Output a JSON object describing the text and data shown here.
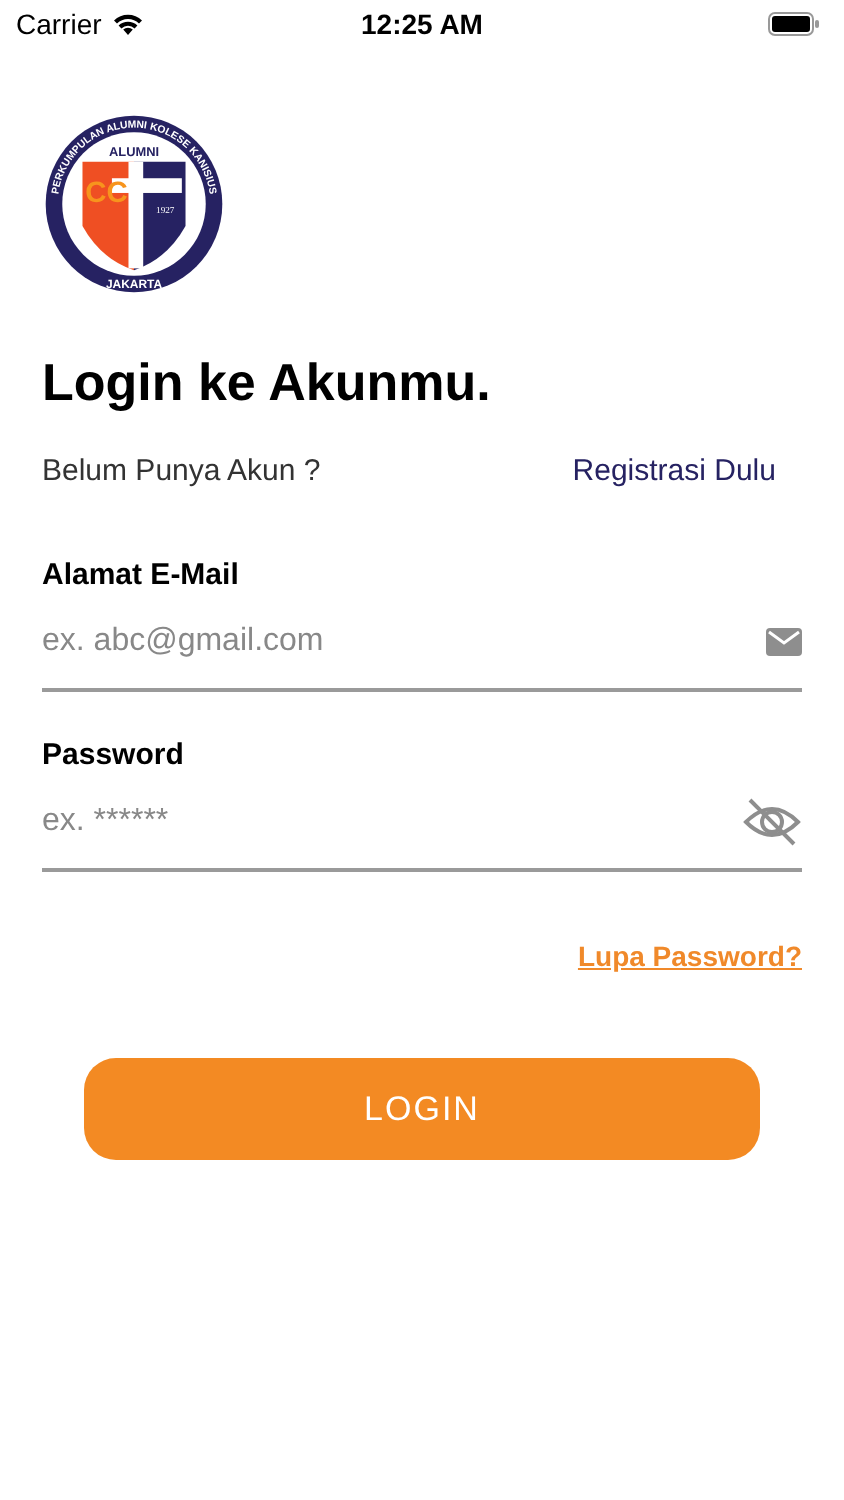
{
  "status_bar": {
    "carrier": "Carrier",
    "time": "12:25 AM"
  },
  "logo": {
    "ring_top": "PERKUMPULAN ALUMNI KOLESE KANISIUS",
    "ring_bottom": "JAKARTA",
    "label": "ALUMNI",
    "letters": "CC",
    "year": "1927"
  },
  "title": "Login ke Akunmu.",
  "register": {
    "prompt": "Belum Punya Akun ?",
    "link": "Registrasi Dulu"
  },
  "fields": [
    {
      "label": "Alamat E-Mail",
      "placeholder": "ex. abc@gmail.com",
      "kind": "email"
    },
    {
      "label": "Password",
      "placeholder": "ex. ******",
      "kind": "password"
    }
  ],
  "forgot_link": "Lupa Password?",
  "login_button": "LOGIN"
}
